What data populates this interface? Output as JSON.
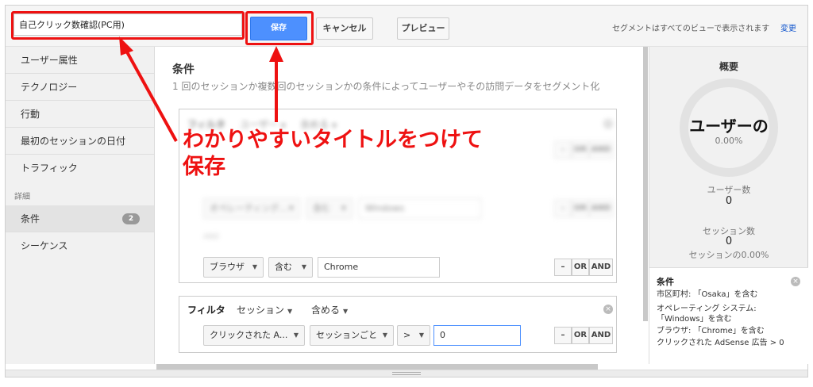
{
  "toolbar": {
    "segment_name_value": "自己クリック数確認(PC用)",
    "save_label": "保存",
    "cancel_label": "キャンセル",
    "preview_label": "プレビュー",
    "segment_note": "セグメントはすべてのビューで表示されます",
    "change_label": "変更"
  },
  "sidebar": {
    "items": [
      {
        "label": "ユーザー属性"
      },
      {
        "label": "テクノロジー"
      },
      {
        "label": "行動"
      },
      {
        "label": "最初のセッションの日付"
      },
      {
        "label": "トラフィック"
      }
    ],
    "section_label": "詳細",
    "advanced": [
      {
        "label": "条件",
        "count": "2"
      },
      {
        "label": "シーケンス"
      }
    ]
  },
  "main": {
    "title": "条件",
    "description": "1 回のセッションか複数回のセッションかの条件によってユーザーやその訪問データをセグメント化",
    "filter1": {
      "label": "フィルタ",
      "scope": "ユーザー",
      "mode": "含める",
      "row1": {
        "minus": "–",
        "or": "OR",
        "and": "AND"
      },
      "row2": {
        "dimension": "オペレーティング...",
        "operator": "含む",
        "value": "Windows",
        "minus": "–",
        "or": "OR",
        "and": "AND"
      },
      "and_separator": "AND",
      "row3": {
        "dimension": "ブラウザ",
        "operator": "含む",
        "value": "Chrome",
        "minus": "–",
        "or": "OR",
        "and": "AND"
      }
    },
    "filter2": {
      "label": "フィルタ",
      "scope": "セッション",
      "mode": "含める",
      "row1": {
        "dimension": "クリックされた A...",
        "per": "セッションごと",
        "operator": ">",
        "value": "0",
        "minus": "–",
        "or": "OR",
        "and": "AND"
      }
    }
  },
  "summary": {
    "title": "概要",
    "ring_label": "ユーザーの",
    "ring_percent": "0.00%",
    "users_label": "ユーザー数",
    "users_value": "0",
    "sessions_label": "セッション数",
    "sessions_value": "0",
    "sessions_percent": "セッションの0.00%",
    "conditions": {
      "title": "条件",
      "lines": [
        "市区町村: 「Osaka」を含む",
        "オペレーティング システム:",
        "「Windows」を含む",
        "ブラウザ: 「Chrome」を含む",
        "クリックされた AdSense 広告 > 0"
      ]
    }
  },
  "annotation": {
    "line1": "わかりやすいタイトルをつけて",
    "line2": "保存",
    "color": "#ee1111"
  },
  "colors": {
    "accent": "#4d90fe",
    "annotation_red": "#ee1111"
  }
}
